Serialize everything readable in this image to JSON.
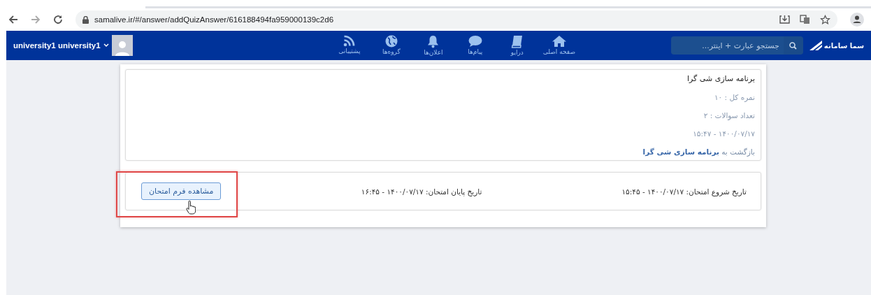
{
  "browser": {
    "url": "samalive.ir/#/answer/addQuizAnswer/616188494fa959000139c2d6"
  },
  "navbar": {
    "logo": "سما سامانه",
    "search": {
      "placeholder": "جستجو عبارت + اینتر..."
    },
    "items": [
      {
        "label": "صفحه اصلی"
      },
      {
        "label": "درایو"
      },
      {
        "label": "پیام‌ها"
      },
      {
        "label": "اعلان‌ها"
      },
      {
        "label": "گروه‌ها"
      },
      {
        "label": "پشتیبانی"
      }
    ],
    "user": "university1 university1"
  },
  "quiz": {
    "title": "برنامه سازی شی گرا",
    "total_score": "نمره کل : ۱۰",
    "question_count": "تعداد سوالات : ۲",
    "date": "۱۴۰۰/۰۷/۱۷ - ۱۵:۴۷",
    "back_link": "بازگشت به **برنامه سازی شی گرا**"
  },
  "exam": {
    "start": "تاریخ شروع امتحان: ۱۴۰۰/۰۷/۱۷ - ۱۵:۴۵",
    "end": "تاریخ پایان امتحان: ۱۴۰۰/۰۷/۱۷ - ۱۶:۴۵",
    "button": "مشاهده فرم امتحان"
  }
}
